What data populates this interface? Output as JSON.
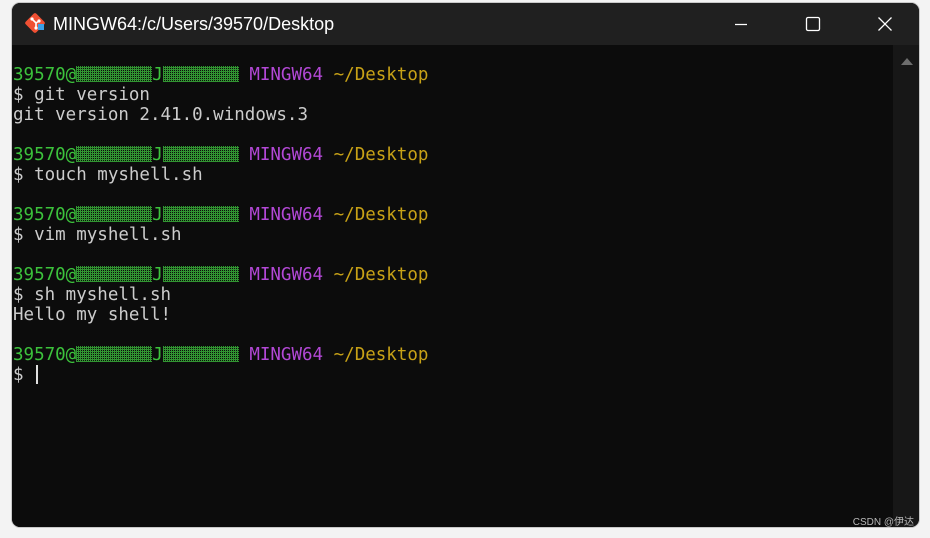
{
  "window": {
    "title": "MINGW64:/c/Users/39570/Desktop",
    "icon": "git-bash-icon"
  },
  "controls": {
    "minimize": "minimize-icon",
    "maximize": "maximize-icon",
    "close": "close-icon"
  },
  "terminal": {
    "prompt_user": "39570@",
    "prompt_host_mid": "J",
    "prompt_env": "MINGW64",
    "prompt_path": "~/Desktop",
    "blocks": [
      {
        "command": "$ git version",
        "output": [
          "git version 2.41.0.windows.3"
        ]
      },
      {
        "command": "$ touch myshell.sh",
        "output": []
      },
      {
        "command": "$ vim myshell.sh",
        "output": []
      },
      {
        "command": "$ sh myshell.sh",
        "output": [
          "Hello my shell!"
        ]
      }
    ],
    "current_prompt": "$ "
  },
  "watermark": "CSDN @伊达",
  "colors": {
    "user": "#3cc33c",
    "env": "#b348d6",
    "path": "#c8a217",
    "text": "#cccccc",
    "background": "#0c0c0c"
  }
}
